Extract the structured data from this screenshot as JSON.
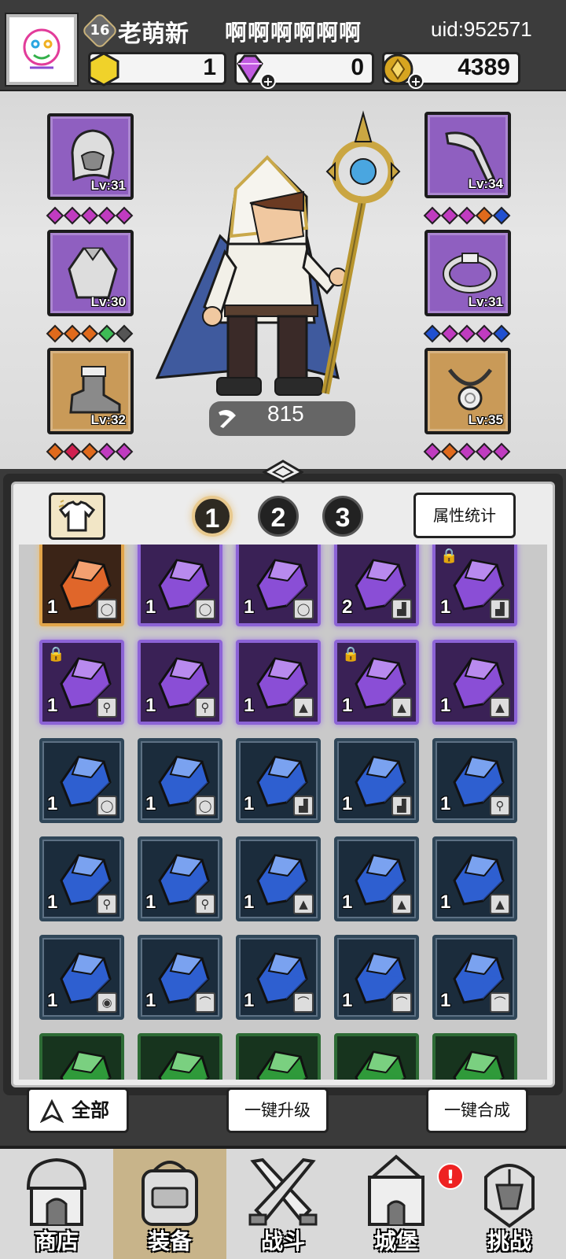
{
  "player": {
    "level": "16",
    "nickname": "老萌新",
    "guild": "啊啊啊啊啊啊",
    "uid": "uid:952571"
  },
  "resources": {
    "gold_gem": "1",
    "diamond": "0",
    "coin": "4389"
  },
  "hero": {
    "power": "815",
    "equipment": {
      "helmet": {
        "level": "Lv:31",
        "gems": [
          "#c03bc0",
          "#c03bc0",
          "#c03bc0",
          "#c03bc0",
          "#c03bc0"
        ]
      },
      "armor": {
        "level": "Lv:30",
        "gems": [
          "#e06a1c",
          "#e06a1c",
          "#e06a1c",
          "#3dbb55",
          "#555555"
        ]
      },
      "boots": {
        "level": "Lv:32",
        "gems": [
          "#e06a1c",
          "#d02050",
          "#e06a1c",
          "#c03bc0",
          "#c03bc0"
        ]
      },
      "weapon": {
        "level": "Lv:34",
        "gems": [
          "#c03bc0",
          "#c03bc0",
          "#c03bc0",
          "#e06a1c",
          "#2050d0"
        ]
      },
      "ring": {
        "level": "Lv:31",
        "gems": [
          "#2050d0",
          "#c03bc0",
          "#c03bc0",
          "#c03bc0",
          "#2050d0"
        ]
      },
      "necklace": {
        "level": "Lv:35",
        "gems": [
          "#c03bc0",
          "#e06a1c",
          "#c03bc0",
          "#c03bc0",
          "#c03bc0"
        ]
      }
    }
  },
  "inventory": {
    "tabs": [
      "1",
      "2",
      "3"
    ],
    "active_tab": "1",
    "stats_button": "属性统计",
    "rows": [
      [
        {
          "rarity": "orange",
          "count": "1",
          "slot_icon": "ring-icon",
          "locked": false
        },
        {
          "rarity": "purple",
          "count": "1",
          "slot_icon": "ring-icon",
          "locked": false
        },
        {
          "rarity": "purple",
          "count": "1",
          "slot_icon": "ring-icon",
          "locked": false
        },
        {
          "rarity": "purple",
          "count": "2",
          "slot_icon": "boot-icon",
          "locked": false
        },
        {
          "rarity": "purple",
          "count": "1",
          "slot_icon": "boot-icon",
          "locked": true
        }
      ],
      [
        {
          "rarity": "purple",
          "count": "1",
          "slot_icon": "weapon-icon",
          "locked": true
        },
        {
          "rarity": "purple",
          "count": "1",
          "slot_icon": "weapon-icon",
          "locked": false
        },
        {
          "rarity": "purple",
          "count": "1",
          "slot_icon": "armor-icon",
          "locked": false
        },
        {
          "rarity": "purple",
          "count": "1",
          "slot_icon": "armor-icon",
          "locked": true
        },
        {
          "rarity": "purple",
          "count": "1",
          "slot_icon": "armor-icon",
          "locked": false
        }
      ],
      [
        {
          "rarity": "blue",
          "count": "1",
          "slot_icon": "ring-icon",
          "locked": false
        },
        {
          "rarity": "blue",
          "count": "1",
          "slot_icon": "ring-icon",
          "locked": false
        },
        {
          "rarity": "blue",
          "count": "1",
          "slot_icon": "boot-icon",
          "locked": false
        },
        {
          "rarity": "blue",
          "count": "1",
          "slot_icon": "boot-icon",
          "locked": false
        },
        {
          "rarity": "blue",
          "count": "1",
          "slot_icon": "weapon-icon",
          "locked": false
        }
      ],
      [
        {
          "rarity": "blue",
          "count": "1",
          "slot_icon": "weapon-icon",
          "locked": false
        },
        {
          "rarity": "blue",
          "count": "1",
          "slot_icon": "weapon-icon",
          "locked": false
        },
        {
          "rarity": "blue",
          "count": "1",
          "slot_icon": "armor-icon",
          "locked": false
        },
        {
          "rarity": "blue",
          "count": "1",
          "slot_icon": "armor-icon",
          "locked": false
        },
        {
          "rarity": "blue",
          "count": "1",
          "slot_icon": "armor-icon",
          "locked": false
        }
      ],
      [
        {
          "rarity": "blue",
          "count": "1",
          "slot_icon": "helmet-icon",
          "locked": false
        },
        {
          "rarity": "blue",
          "count": "1",
          "slot_icon": "necklace-icon",
          "locked": false
        },
        {
          "rarity": "blue",
          "count": "1",
          "slot_icon": "necklace-icon",
          "locked": false
        },
        {
          "rarity": "blue",
          "count": "1",
          "slot_icon": "necklace-icon",
          "locked": false
        },
        {
          "rarity": "blue",
          "count": "1",
          "slot_icon": "necklace-icon",
          "locked": false
        }
      ],
      [
        {
          "rarity": "green",
          "count": "",
          "slot_icon": "",
          "locked": false
        },
        {
          "rarity": "green",
          "count": "",
          "slot_icon": "",
          "locked": false
        },
        {
          "rarity": "green",
          "count": "",
          "slot_icon": "",
          "locked": false
        },
        {
          "rarity": "green",
          "count": "",
          "slot_icon": "",
          "locked": false
        },
        {
          "rarity": "green",
          "count": "",
          "slot_icon": "",
          "locked": false
        }
      ]
    ]
  },
  "actions": {
    "filter_all": "全部",
    "upgrade_all": "一键升级",
    "merge_all": "一键合成"
  },
  "nav": {
    "items": [
      {
        "label": "商店",
        "icon": "shop-icon",
        "active": false
      },
      {
        "label": "装备",
        "icon": "backpack-icon",
        "active": true
      },
      {
        "label": "战斗",
        "icon": "crossed-swords-icon",
        "active": false
      },
      {
        "label": "城堡",
        "icon": "castle-icon",
        "active": false,
        "alert": "!"
      },
      {
        "label": "挑战",
        "icon": "helmet-challenge-icon",
        "active": false
      }
    ]
  },
  "colors": {
    "orange_rarity": "#e2a54a",
    "purple_rarity": "#8c63d6",
    "blue_rarity": "#2f4658",
    "green_rarity": "#2d6b35"
  }
}
